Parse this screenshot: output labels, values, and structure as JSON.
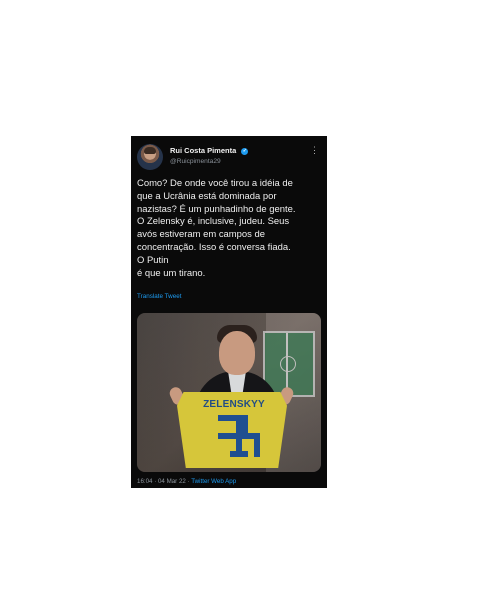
{
  "tweet": {
    "name": "Rui Costa Pimenta",
    "handle": "@Ruicpimenta29",
    "text": "Como? De onde você tirou a idéia de\nque a Ucrânia está dominada por\nnazistas? É um punhadinho de gente.\nO Zelensky é, inclusive, judeu. Seus\navós estiveram em campos de\nconcentração. Isso é conversa fiada.\nO Putin\né que um tirano.",
    "translate_label": "Translate Tweet",
    "timestamp": "16:04 · 04 Mar 22 · ",
    "source": "Twitter Web App"
  },
  "media": {
    "jersey_text": "ZELENSKYY"
  },
  "icons": {
    "verified": "verified-badge",
    "more": "more-options"
  },
  "colors": {
    "background": "#0a0a0a",
    "accent": "#1d9bf0",
    "text": "#efefef",
    "muted": "#8a9199"
  }
}
